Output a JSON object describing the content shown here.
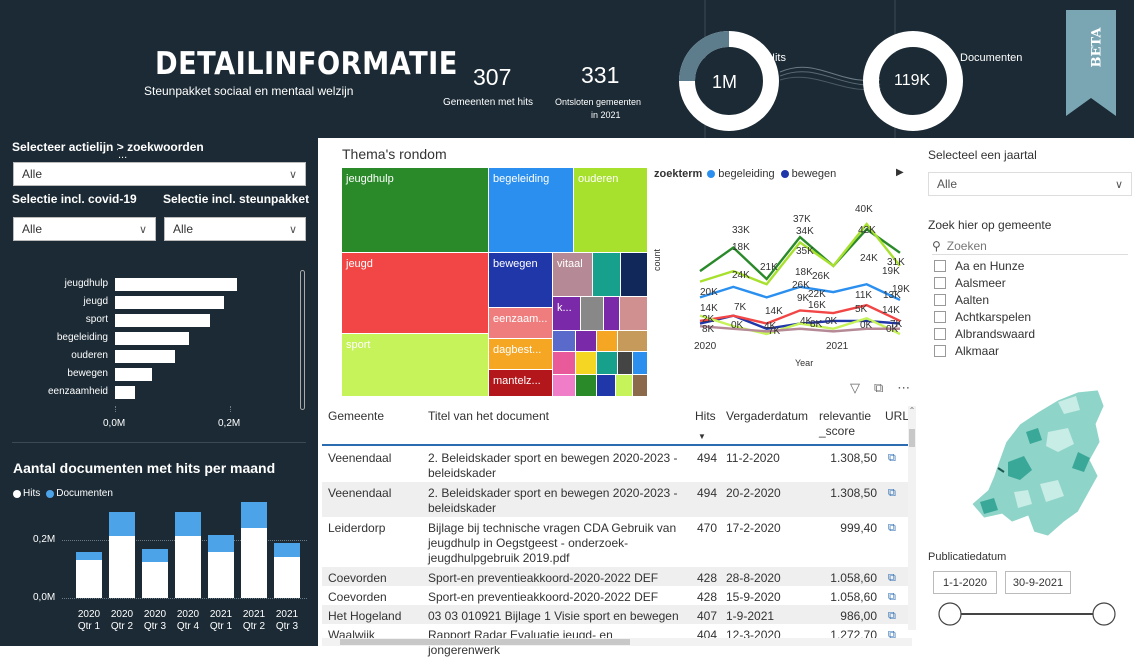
{
  "header": {
    "title": "DETAILINFORMATIE",
    "subtitle": "Steunpakket sociaal en mentaal welzijn",
    "kpi1_value": "307",
    "kpi1_label": "Gemeenten met hits",
    "kpi2_value": "331",
    "kpi2_label_line1": "Ontsloten gemeenten",
    "kpi2_label_line2": "in 2021",
    "donut1_value": "1M",
    "donut1_label": "Hits",
    "donut2_value": "119K",
    "donut2_label": "Documenten",
    "beta_badge": "BETA"
  },
  "filters": {
    "actielijn_label": "Selecteer actielijn > zoekwoorden",
    "actielijn_value": "Alle",
    "covid_label": "Selectie incl. covid-19",
    "covid_value": "Alle",
    "steunpakket_label": "Selectie incl. steunpakket",
    "steunpakket_value": "Alle",
    "more_dots": "..."
  },
  "keyword_bars": {
    "items": [
      {
        "label": "jeugdhulp",
        "value": 0.213
      },
      {
        "label": "jeugd",
        "value": 0.19
      },
      {
        "label": "sport",
        "value": 0.165
      },
      {
        "label": "begeleiding",
        "value": 0.128
      },
      {
        "label": "ouderen",
        "value": 0.105
      },
      {
        "label": "bewegen",
        "value": 0.065
      },
      {
        "label": "eenzaamheid",
        "value": 0.035
      }
    ],
    "ticks": [
      "0,0M",
      "0,2M"
    ]
  },
  "monthly": {
    "title": "Aantal documenten met hits per maand",
    "legend_hits": "Hits",
    "legend_docs": "Documenten",
    "y_ticks": [
      "0,2M",
      "0,0M"
    ],
    "categories": [
      [
        "2020",
        "Qtr 1"
      ],
      [
        "2020",
        "Qtr 2"
      ],
      [
        "2020",
        "Qtr 3"
      ],
      [
        "2020",
        "Qtr 4"
      ],
      [
        "2021",
        "Qtr 1"
      ],
      [
        "2021",
        "Qtr 2"
      ],
      [
        "2021",
        "Qtr 3"
      ]
    ],
    "colors": {
      "hits": "#ffffff",
      "docs": "#4da3e8"
    }
  },
  "treemap": {
    "title": "Thema's rondom",
    "tiles": [
      {
        "label": "jeugdhulp",
        "color": "#2a8a2a"
      },
      {
        "label": "begeleiding",
        "color": "#2b8ff0"
      },
      {
        "label": "ouderen",
        "color": "#a8e02e"
      },
      {
        "label": "jeugd",
        "color": "#f24545"
      },
      {
        "label": "bewegen",
        "color": "#1f37a8"
      },
      {
        "label": "vitaal",
        "color": "#b58a96"
      },
      {
        "label": "sport",
        "color": "#c6f25a"
      },
      {
        "label": "eenzaam...",
        "color": "#f07d7d"
      },
      {
        "label": "k...",
        "color": "#7a2aa8"
      },
      {
        "label": "dagbest...",
        "color": "#f5a623"
      },
      {
        "label": "mantelz...",
        "color": "#b3161b"
      }
    ]
  },
  "chart_data": {
    "type": "line",
    "legend_title": "zoekterm",
    "ylabel": "count",
    "xlabel": "Year",
    "x_ticks": [
      "2020",
      "2021"
    ],
    "series": [
      {
        "name": "begeleiding",
        "color": "#2b8ff0",
        "values": [
          14,
          18,
          14,
          18,
          16,
          19,
          13
        ]
      },
      {
        "name": "bewegen",
        "color": "#1f37a8",
        "values": [
          4,
          7,
          2,
          4,
          5,
          5,
          4
        ]
      },
      {
        "series_color": "#2a8a2a",
        "color": "#2a8a2a",
        "values": [
          24,
          33,
          21,
          37,
          26,
          40,
          31
        ]
      },
      {
        "color": "#a8e02e",
        "values": [
          20,
          24,
          19,
          35,
          26,
          42,
          26
        ]
      },
      {
        "color": "#f24545",
        "values": [
          5,
          7,
          4,
          9,
          8,
          11,
          5
        ]
      },
      {
        "color": "#c6f25a",
        "values": [
          7,
          3,
          0,
          4,
          2,
          6,
          0
        ]
      },
      {
        "color": "#b58a96",
        "values": [
          3,
          2,
          1,
          2,
          1,
          2,
          2
        ]
      }
    ],
    "data_labels": [
      "37K",
      "40K",
      "33K",
      "34K",
      "35K",
      "42K",
      "24K",
      "21K",
      "24K",
      "26K",
      "31K",
      "18K",
      "18K",
      "19K",
      "26K",
      "19K",
      "20K",
      "9K",
      "22K",
      "11K",
      "13K",
      "14K",
      "7K",
      "14K",
      "16K",
      "5K",
      "14K",
      "2K",
      "4K",
      "4K",
      "0K",
      "0K",
      "7K",
      "0K",
      "8K",
      "0K",
      "8K",
      "7K"
    ]
  },
  "table": {
    "columns": [
      "Gemeente",
      "Titel van het document",
      "Hits",
      "Vergaderdatum",
      "relevantie _score",
      "URL"
    ],
    "relevantie_line1": "relevantie",
    "relevantie_line2": "_score",
    "rows": [
      {
        "gemeente": "Veenendaal",
        "titel1": "2. Beleidskader sport en bewegen 2020-2023 -",
        "titel2": "beleidskader",
        "titel3": "",
        "hits": "494",
        "datum": "11-2-2020",
        "score": "1.308,50"
      },
      {
        "gemeente": "Veenendaal",
        "titel1": "2. Beleidskader sport en bewegen 2020-2023 -",
        "titel2": "beleidskader",
        "titel3": "",
        "hits": "494",
        "datum": "20-2-2020",
        "score": "1.308,50"
      },
      {
        "gemeente": "Leiderdorp",
        "titel1": "Bijlage bij technische vragen CDA Gebruik van",
        "titel2": "jeugdhulp in Oegstgeest - onderzoek-",
        "titel3": "jeugdhulpgebruik 2019.pdf",
        "hits": "470",
        "datum": "17-2-2020",
        "score": "999,40"
      },
      {
        "gemeente": "Coevorden",
        "titel1": "Sport-en preventieakkoord-2020-2022 DEF",
        "titel2": "",
        "titel3": "",
        "hits": "428",
        "datum": "28-8-2020",
        "score": "1.058,60"
      },
      {
        "gemeente": "Coevorden",
        "titel1": "Sport-en preventieakkoord-2020-2022 DEF",
        "titel2": "",
        "titel3": "",
        "hits": "428",
        "datum": "15-9-2020",
        "score": "1.058,60"
      },
      {
        "gemeente": "Het Hogeland",
        "titel1": "03 03 010921 Bijlage 1 Visie sport en bewegen",
        "titel2": "",
        "titel3": "",
        "hits": "407",
        "datum": "1-9-2021",
        "score": "986,00"
      },
      {
        "gemeente": "Waalwijk",
        "titel1": "Rapport Radar Evaluatie jeugd- en jongerenwerk",
        "titel2": "",
        "titel3": "",
        "hits": "404",
        "datum": "12-3-2020",
        "score": "1.272,70"
      }
    ]
  },
  "right": {
    "year_label": "Selecteel een jaartal",
    "year_value": "Alle",
    "gemeente_label": "Zoek hier op gemeente",
    "search_placeholder": "Zoeken",
    "gemeenten": [
      "Aa en Hunze",
      "Aalsmeer",
      "Aalten",
      "Achtkarspelen",
      "Albrandswaard",
      "Alkmaar"
    ],
    "pub_label": "Publicatiedatum",
    "date_from": "1-1-2020",
    "date_to": "30-9-2021"
  }
}
